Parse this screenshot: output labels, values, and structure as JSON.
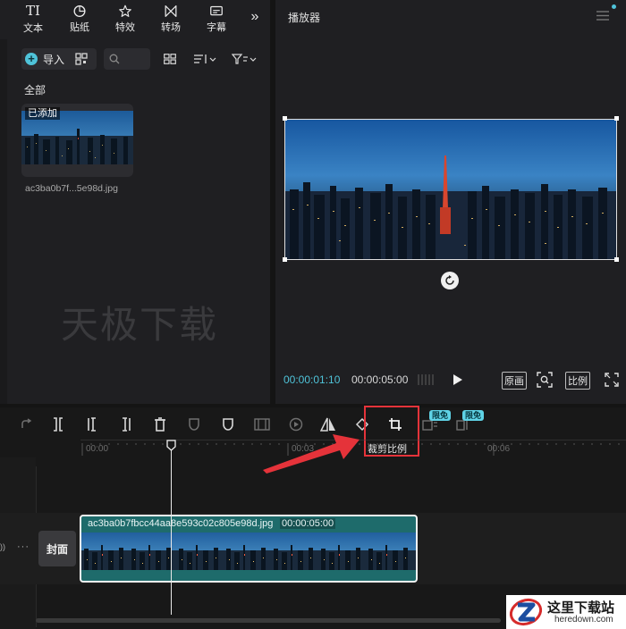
{
  "toolbar": {
    "tabs": [
      {
        "label": "文本",
        "glyph": "TI"
      },
      {
        "label": "贴纸",
        "glyph": ""
      },
      {
        "label": "特效",
        "glyph": ""
      },
      {
        "label": "转场",
        "glyph": ""
      },
      {
        "label": "字幕",
        "glyph": ""
      }
    ]
  },
  "media": {
    "import_label": "导入",
    "filter_label": "全部",
    "item": {
      "badge": "已添加",
      "filename": "ac3ba0b7f...5e98d.jpg"
    }
  },
  "watermark": "天极下载",
  "player": {
    "title": "播放器",
    "current_time": "00:00:01:10",
    "total_time": "00:00:05:00",
    "original_label": "原画",
    "ratio_label": "比例"
  },
  "timeline": {
    "badges": [
      "限免",
      "限免"
    ],
    "tooltip": "裁剪比例",
    "ruler": [
      "00:00",
      "00:03",
      "00:06"
    ],
    "cover_label": "封面",
    "clip": {
      "name": "ac3ba0b7fbcc44aa8e593c02c805e98d.jpg",
      "duration": "00:00:05:00"
    }
  },
  "site_logo": {
    "name": "这里下载站",
    "url": "heredown.com"
  },
  "colors": {
    "accent": "#4fc3d9",
    "highlight": "#e5333a",
    "clip_bg": "#1e6b6b"
  }
}
